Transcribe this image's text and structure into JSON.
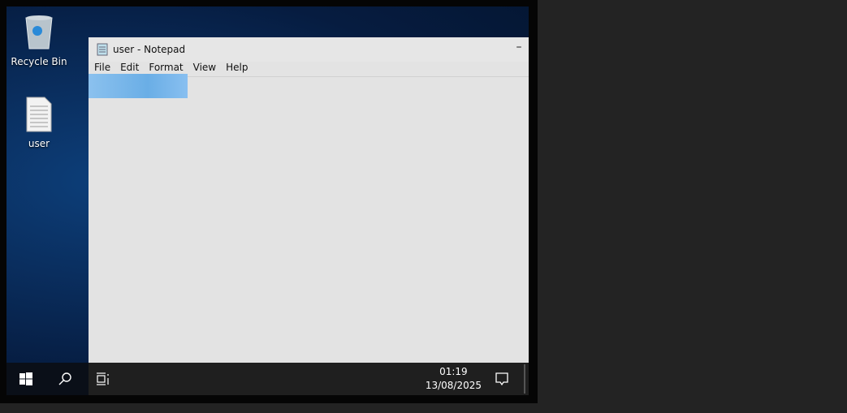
{
  "desktop": {
    "icons": [
      {
        "label": "Recycle Bin",
        "icon": "recycle-bin-icon"
      },
      {
        "label": "user",
        "icon": "text-file-icon"
      }
    ]
  },
  "notepad": {
    "title": "user - Notepad",
    "minimize": "–",
    "menu": [
      "File",
      "Edit",
      "Format",
      "View",
      "Help"
    ],
    "selection_color": "#6aaee6"
  },
  "taskbar": {
    "time": "01:19",
    "date": "13/08/2025"
  }
}
